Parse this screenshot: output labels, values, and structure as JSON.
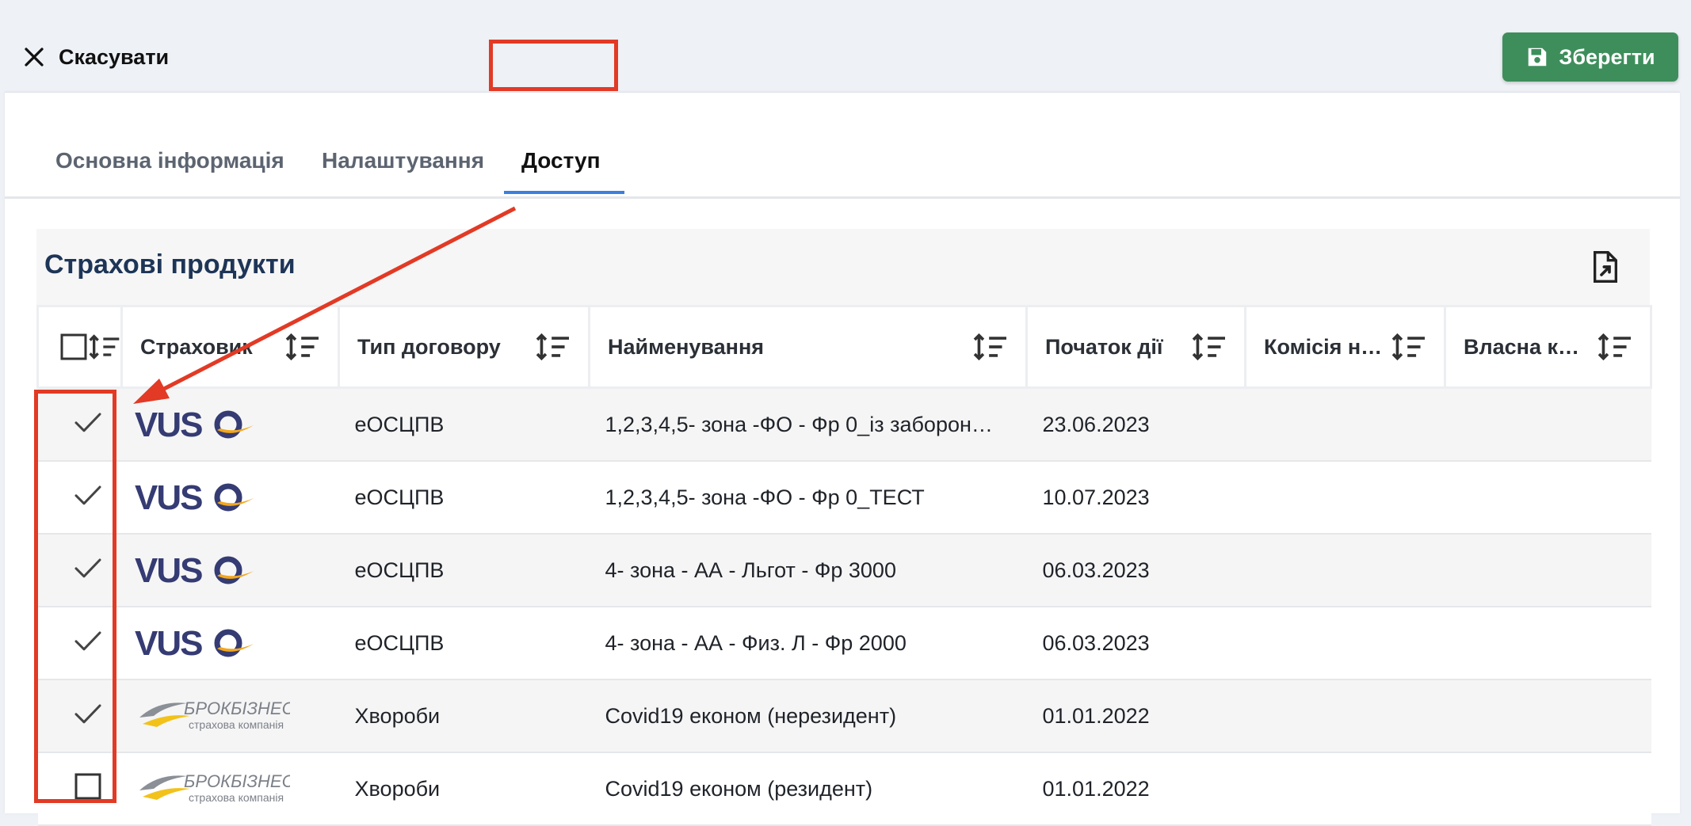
{
  "topbar": {
    "cancel_label": "Скасувати",
    "save_label": "Зберегти"
  },
  "tabs": [
    {
      "label": "Основна інформація",
      "active": false
    },
    {
      "label": "Налаштування",
      "active": false
    },
    {
      "label": "Доступ",
      "active": true
    }
  ],
  "panel": {
    "title": "Страхові продукти"
  },
  "table": {
    "columns": [
      "",
      "Страховик",
      "Тип договору",
      "Найменування",
      "Початок дії",
      "Комісія н…",
      "Власна к…"
    ],
    "rows": [
      {
        "checked": true,
        "insurer_logo": "VUSO",
        "type": "еОСЦПВ",
        "name": "1,2,3,4,5- зона -ФО - Фр 0_із заборон…",
        "start": "23.06.2023",
        "commission": "",
        "own": ""
      },
      {
        "checked": true,
        "insurer_logo": "VUSO",
        "type": "еОСЦПВ",
        "name": "1,2,3,4,5- зона -ФО - Фр 0_ТЕСТ",
        "start": "10.07.2023",
        "commission": "",
        "own": ""
      },
      {
        "checked": true,
        "insurer_logo": "VUSO",
        "type": "еОСЦПВ",
        "name": "4- зона - АА - Льгот - Фр 3000",
        "start": "06.03.2023",
        "commission": "",
        "own": ""
      },
      {
        "checked": true,
        "insurer_logo": "VUSO",
        "type": "еОСЦПВ",
        "name": "4- зона - АА - Физ. Л - Фр 2000",
        "start": "06.03.2023",
        "commission": "",
        "own": ""
      },
      {
        "checked": true,
        "insurer_logo": "БРОКБІЗНЕС",
        "type": "Хвороби",
        "name": "Covid19 економ (нерезидент)",
        "start": "01.01.2022",
        "commission": "",
        "own": ""
      },
      {
        "checked": false,
        "insurer_logo": "БРОКБІЗНЕС",
        "type": "Хвороби",
        "name": "Covid19 економ (резидент)",
        "start": "01.01.2022",
        "commission": "",
        "own": ""
      }
    ]
  },
  "logos": {
    "vuso_text": "VUSO",
    "brok_name": "БРОКБІЗНЕС",
    "brok_sub": "страхова компанія"
  },
  "icons": {
    "cancel": "close-icon",
    "save": "floppy-disk-icon",
    "export": "file-export-icon",
    "sort": "sort-icon",
    "check": "checkmark-icon"
  },
  "colors": {
    "save_green": "#3e8e5b",
    "annotation_red": "#e23a25",
    "tab_underline": "#3a7fe0",
    "title_navy": "#1d3557",
    "vuso_navy": "#353b73",
    "vuso_orange": "#f2a71b"
  }
}
